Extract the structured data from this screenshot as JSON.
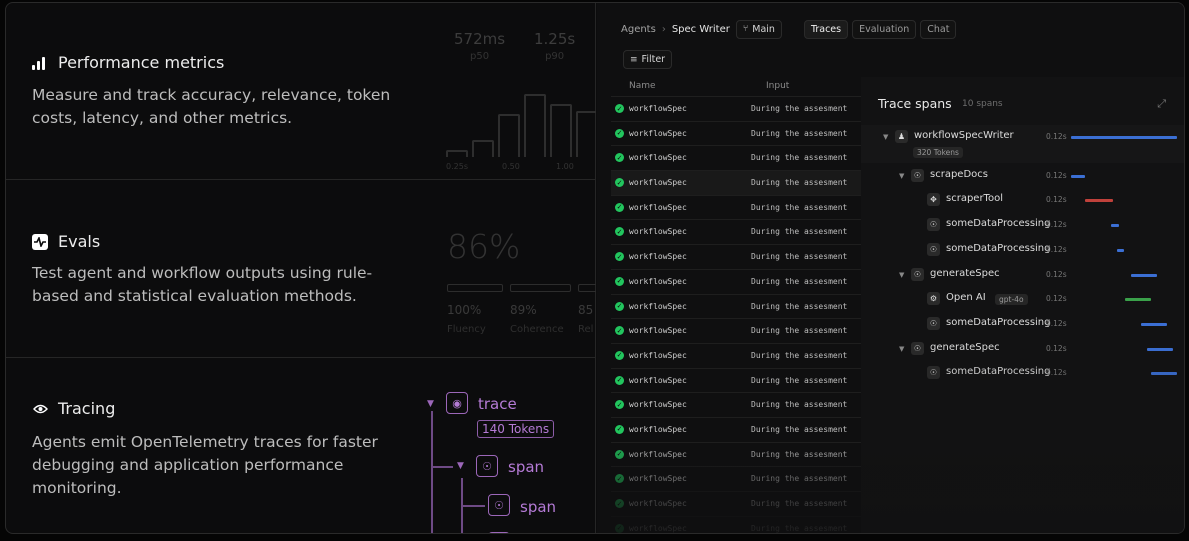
{
  "features": [
    {
      "icon": "bar-chart-icon",
      "title": "Performance metrics",
      "desc": "Measure and track accuracy, relevance, token costs, latency, and other metrics."
    },
    {
      "icon": "activity-icon",
      "title": "Evals",
      "desc": "Test agent and workflow outputs using rule-based and statistical evaluation methods."
    },
    {
      "icon": "eye-icon",
      "title": "Tracing",
      "desc": "Agents emit OpenTelemetry traces for faster debugging and application performance monitoring."
    }
  ],
  "perf": {
    "stats": [
      {
        "value": "572ms",
        "label": "p50"
      },
      {
        "value": "1.25s",
        "label": "p90"
      }
    ],
    "histogram_levels": [
      0.1,
      0.25,
      0.65,
      0.95,
      0.8,
      0.7
    ],
    "ticks": [
      "0.25s",
      "0.50",
      "1.00"
    ]
  },
  "evals": {
    "overall": "86%",
    "metrics": [
      {
        "value": "100%",
        "label": "Fluency"
      },
      {
        "value": "89%",
        "label": "Coherence"
      },
      {
        "value": "85",
        "label": "Rel"
      }
    ]
  },
  "tracing_demo": {
    "root": "trace",
    "tokens": "140 Tokens",
    "child1": "span",
    "child2": "span"
  },
  "app": {
    "breadcrumb": [
      "Agents",
      "Spec Writer"
    ],
    "branch": "Main",
    "tabs": [
      "Traces",
      "Evaluation",
      "Chat"
    ],
    "active_tab": "Traces",
    "filter_label": "Filter",
    "columns": {
      "name": "Name",
      "input": "Input"
    },
    "rows": [
      {
        "name": "workflowSpec",
        "input": "During the assesment"
      },
      {
        "name": "workflowSpec",
        "input": "During the assesment"
      },
      {
        "name": "workflowSpec",
        "input": "During the assesment"
      },
      {
        "name": "workflowSpec",
        "input": "During the assesment"
      },
      {
        "name": "workflowSpec",
        "input": "During the assesment"
      },
      {
        "name": "workflowSpec",
        "input": "During the assesment"
      },
      {
        "name": "workflowSpec",
        "input": "During the assesment"
      },
      {
        "name": "workflowSpec",
        "input": "During the assesment"
      },
      {
        "name": "workflowSpec",
        "input": "During the assesment"
      },
      {
        "name": "workflowSpec",
        "input": "During the assesment"
      },
      {
        "name": "workflowSpec",
        "input": "During the assesment"
      },
      {
        "name": "workflowSpec",
        "input": "During the assesment"
      },
      {
        "name": "workflowSpec",
        "input": "During the assesment"
      },
      {
        "name": "workflowSpec",
        "input": "During the assesment"
      },
      {
        "name": "workflowSpec",
        "input": "During the assesment"
      },
      {
        "name": "workflowSpec",
        "input": "During the assesment"
      },
      {
        "name": "workflowSpec",
        "input": "During the assesment"
      },
      {
        "name": "workflowSpec",
        "input": "During the assesment"
      }
    ],
    "selected_row": 3
  },
  "trace_spans": {
    "title": "Trace spans",
    "count": "10 spans",
    "spans": [
      {
        "name": "workflowSpecWriter",
        "depth": 0,
        "caret": true,
        "icon": "workflow-icon",
        "tag": "320 Tokens",
        "time": "0.12s",
        "bar_color": "#3b6fd4"
      },
      {
        "name": "scrapeDocs",
        "depth": 1,
        "caret": true,
        "icon": "agent-icon",
        "time": "0.12s",
        "bar_color": "#3b6fd4"
      },
      {
        "name": "scraperTool",
        "depth": 2,
        "caret": false,
        "icon": "tool-icon",
        "time": "0.12s",
        "bar_color": "#c0413b"
      },
      {
        "name": "someDataProcessing",
        "depth": 2,
        "caret": false,
        "icon": "agent-icon",
        "time": "0.12s",
        "bar_color": "#3b6fd4"
      },
      {
        "name": "someDataProcessing",
        "depth": 2,
        "caret": false,
        "icon": "agent-icon",
        "time": "0.12s",
        "bar_color": "#3b6fd4"
      },
      {
        "name": "generateSpec",
        "depth": 1,
        "caret": true,
        "icon": "agent-icon",
        "time": "0.12s",
        "bar_color": "#3b6fd4"
      },
      {
        "name": "Open AI",
        "depth": 2,
        "caret": false,
        "icon": "openai-icon",
        "tag": "gpt-4o",
        "time": "0.12s",
        "bar_color": "#3aa14a"
      },
      {
        "name": "someDataProcessing",
        "depth": 2,
        "caret": false,
        "icon": "agent-icon",
        "time": "0.12s",
        "bar_color": "#3b6fd4"
      },
      {
        "name": "generateSpec",
        "depth": 1,
        "caret": true,
        "icon": "agent-icon",
        "time": "0.12s",
        "bar_color": "#3b6fd4"
      },
      {
        "name": "someDataProcessing",
        "depth": 2,
        "caret": false,
        "icon": "agent-icon",
        "time": "0.12s",
        "bar_color": "#3b6fd4"
      }
    ]
  }
}
